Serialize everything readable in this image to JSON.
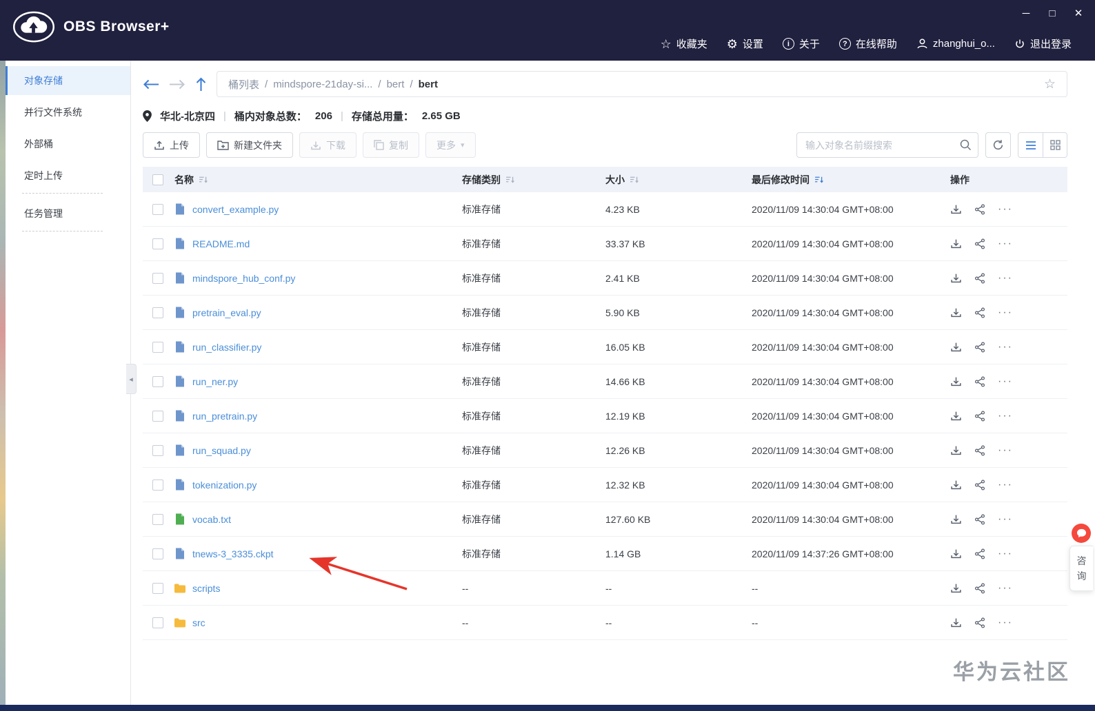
{
  "window": {
    "minimize": "─",
    "maximize": "□",
    "close": "✕"
  },
  "brand": {
    "title": "OBS Browser+"
  },
  "topbar": {
    "favorites": "收藏夹",
    "settings": "设置",
    "about": "关于",
    "help": "在线帮助",
    "user": "zhanghui_o...",
    "logout": "退出登录"
  },
  "icons": {
    "star": "☆",
    "gear": "⚙",
    "info": "i",
    "question": "?",
    "caret_down": "▾",
    "more_dots": "···",
    "collapse": "◂",
    "bc_star": "☆"
  },
  "sidebar": {
    "items": [
      {
        "label": "对象存储"
      },
      {
        "label": "并行文件系统"
      },
      {
        "label": "外部桶"
      },
      {
        "label": "定时上传"
      },
      {
        "label": "任务管理"
      }
    ]
  },
  "breadcrumb": {
    "separator": "/",
    "parts": [
      "桶列表",
      "mindspore-21day-si...",
      "bert",
      "bert"
    ]
  },
  "info": {
    "region": "华北-北京四",
    "divider": "|",
    "count_label": "桶内对象总数：",
    "count_value": "206",
    "usage_label": "存储总用量：",
    "usage_value": "2.65 GB"
  },
  "toolbar": {
    "upload": "上传",
    "new_folder": "新建文件夹",
    "download": "下载",
    "copy": "复制",
    "more": "更多",
    "search_placeholder": "输入对象名前缀搜索"
  },
  "table": {
    "headers": {
      "name": "名称",
      "storage": "存储类别",
      "size": "大小",
      "modified": "最后修改时间",
      "ops": "操作"
    },
    "rows": [
      {
        "icon": "file-blue",
        "name": "convert_example.py",
        "storage": "标准存储",
        "size": "4.23 KB",
        "modified": "2020/11/09 14:30:04 GMT+08:00"
      },
      {
        "icon": "file-blue",
        "name": "README.md",
        "storage": "标准存储",
        "size": "33.37 KB",
        "modified": "2020/11/09 14:30:04 GMT+08:00"
      },
      {
        "icon": "file-blue",
        "name": "mindspore_hub_conf.py",
        "storage": "标准存储",
        "size": "2.41 KB",
        "modified": "2020/11/09 14:30:04 GMT+08:00"
      },
      {
        "icon": "file-blue",
        "name": "pretrain_eval.py",
        "storage": "标准存储",
        "size": "5.90 KB",
        "modified": "2020/11/09 14:30:04 GMT+08:00"
      },
      {
        "icon": "file-blue",
        "name": "run_classifier.py",
        "storage": "标准存储",
        "size": "16.05 KB",
        "modified": "2020/11/09 14:30:04 GMT+08:00"
      },
      {
        "icon": "file-blue",
        "name": "run_ner.py",
        "storage": "标准存储",
        "size": "14.66 KB",
        "modified": "2020/11/09 14:30:04 GMT+08:00"
      },
      {
        "icon": "file-blue",
        "name": "run_pretrain.py",
        "storage": "标准存储",
        "size": "12.19 KB",
        "modified": "2020/11/09 14:30:04 GMT+08:00"
      },
      {
        "icon": "file-blue",
        "name": "run_squad.py",
        "storage": "标准存储",
        "size": "12.26 KB",
        "modified": "2020/11/09 14:30:04 GMT+08:00"
      },
      {
        "icon": "file-blue",
        "name": "tokenization.py",
        "storage": "标准存储",
        "size": "12.32 KB",
        "modified": "2020/11/09 14:30:04 GMT+08:00"
      },
      {
        "icon": "file-green",
        "name": "vocab.txt",
        "storage": "标准存储",
        "size": "127.60 KB",
        "modified": "2020/11/09 14:30:04 GMT+08:00"
      },
      {
        "icon": "file-blue",
        "name": "tnews-3_3335.ckpt",
        "storage": "标准存储",
        "size": "1.14 GB",
        "modified": "2020/11/09 14:37:26 GMT+08:00"
      },
      {
        "icon": "folder",
        "name": "scripts",
        "storage": "--",
        "size": "--",
        "modified": "--"
      },
      {
        "icon": "folder",
        "name": "src",
        "storage": "--",
        "size": "--",
        "modified": "--"
      }
    ]
  },
  "consult": {
    "label": "咨\n询"
  },
  "footer": {
    "watermark": "华为云社区"
  }
}
